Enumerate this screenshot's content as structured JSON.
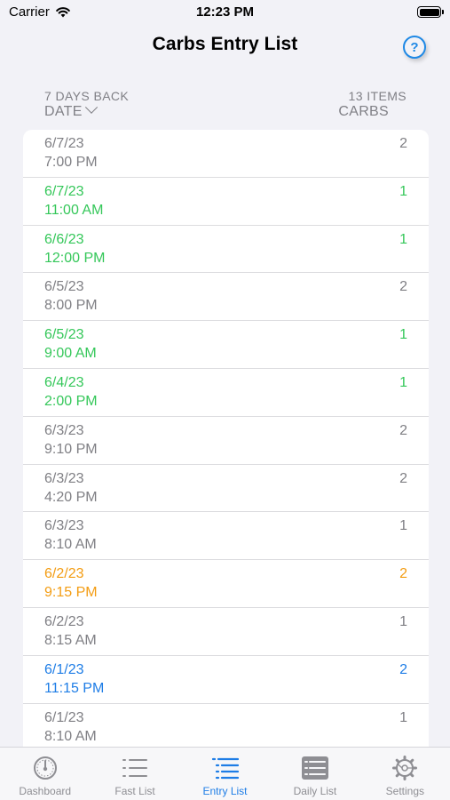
{
  "status": {
    "carrier": "Carrier",
    "time": "12:23 PM"
  },
  "nav": {
    "title": "Carbs Entry List",
    "help_label": "?"
  },
  "header": {
    "range_label": "7 DAYS BACK",
    "date_label": "DATE",
    "count_label": "13 ITEMS",
    "carbs_label": "CARBS"
  },
  "colors": {
    "gray": "#7f7f84",
    "green": "#34c759",
    "orange": "#f39c12",
    "blue": "#1e7de6"
  },
  "entries": [
    {
      "date": "6/7/23",
      "time": "7:00 PM",
      "carbs": "2",
      "color": "gray"
    },
    {
      "date": "6/7/23",
      "time": "11:00 AM",
      "carbs": "1",
      "color": "green"
    },
    {
      "date": "6/6/23",
      "time": "12:00 PM",
      "carbs": "1",
      "color": "green"
    },
    {
      "date": "6/5/23",
      "time": "8:00 PM",
      "carbs": "2",
      "color": "gray"
    },
    {
      "date": "6/5/23",
      "time": "9:00 AM",
      "carbs": "1",
      "color": "green"
    },
    {
      "date": "6/4/23",
      "time": "2:00 PM",
      "carbs": "1",
      "color": "green"
    },
    {
      "date": "6/3/23",
      "time": "9:10 PM",
      "carbs": "2",
      "color": "gray"
    },
    {
      "date": "6/3/23",
      "time": "4:20 PM",
      "carbs": "2",
      "color": "gray"
    },
    {
      "date": "6/3/23",
      "time": "8:10 AM",
      "carbs": "1",
      "color": "gray"
    },
    {
      "date": "6/2/23",
      "time": "9:15 PM",
      "carbs": "2",
      "color": "orange"
    },
    {
      "date": "6/2/23",
      "time": "8:15 AM",
      "carbs": "1",
      "color": "gray"
    },
    {
      "date": "6/1/23",
      "time": "11:15 PM",
      "carbs": "2",
      "color": "blue"
    },
    {
      "date": "6/1/23",
      "time": "8:10 AM",
      "carbs": "1",
      "color": "gray"
    }
  ],
  "tabs": [
    {
      "label": "Dashboard",
      "icon": "dashboard-gauge-icon",
      "active": false
    },
    {
      "label": "Fast List",
      "icon": "list-icon",
      "active": false
    },
    {
      "label": "Entry List",
      "icon": "entry-list-icon",
      "active": true
    },
    {
      "label": "Daily List",
      "icon": "daily-list-icon",
      "active": false
    },
    {
      "label": "Settings",
      "icon": "settings-gear-icon",
      "active": false
    }
  ]
}
